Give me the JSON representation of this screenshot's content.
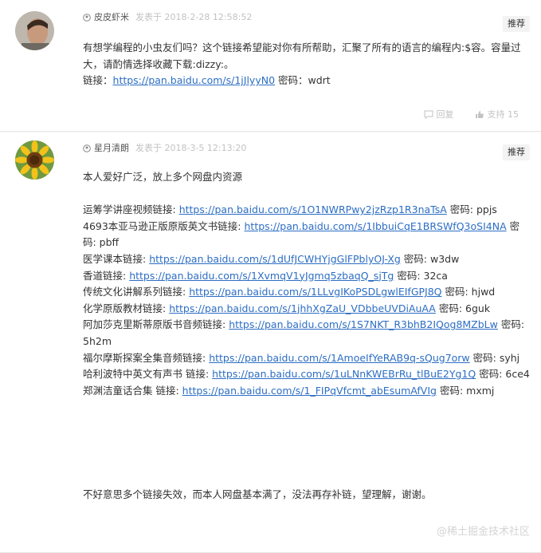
{
  "post1": {
    "username": "皮皮虾米",
    "time": "发表于 2018-2-28 12:58:52",
    "recommend": "推荐",
    "text1": "有想学编程的小虫友们吗？这个链接希望能对你有所帮助，汇聚了所有的语言的编程内:$容。容量过大，请酌情选择收藏下载:dizzy:。",
    "link_label": "链接：",
    "link": "https://pan.baidu.com/s/1jJlyyN0",
    "pwd": " 密码：wdrt",
    "reply": "回复",
    "support": "支持 15"
  },
  "post2": {
    "username": "星月清朗",
    "time": "发表于 2018-3-5 12:13:20",
    "recommend": "推荐",
    "intro": "本人爱好广泛，放上多个网盘内资源",
    "items": [
      {
        "label": "运筹学讲座视频链接: ",
        "link": "https://pan.baidu.com/s/1O1NWRPwy2jzRzp1R3naTsA",
        "pwd": " 密码: ppjs"
      },
      {
        "label": "4693本亚马逊正版原版英文书链接: ",
        "link": "https://pan.baidu.com/s/1IbbuiCqE1BRSWfQ3oSI4NA",
        "pwd": " 密码: pbff"
      },
      {
        "label": "医学课本链接: ",
        "link": "https://pan.baidu.com/s/1dUfJCWHYjgGlFPblyOJ-Xg",
        "pwd": " 密码: w3dw"
      },
      {
        "label": "香道链接: ",
        "link": "https://pan.baidu.com/s/1XvmqV1yJgmq5zbaqQ_sjTg",
        "pwd": " 密码: 32ca"
      },
      {
        "label": "传统文化讲解系列链接: ",
        "link": "https://pan.baidu.com/s/1LLvgIKoPSDLgwlEIfGPJ8Q",
        "pwd": " 密码: hjwd"
      },
      {
        "label": "化学原版教材链接: ",
        "link": "https://pan.baidu.com/s/1jhhXgZaU_VDbbeUVDiAuAA",
        "pwd": " 密码: 6guk"
      },
      {
        "label": "阿加莎克里斯蒂原版书音频链接: ",
        "link": "https://pan.baidu.com/s/1S7NKT_R3bhB2IQog8MZbLw",
        "pwd": " 密码: 5h2m"
      },
      {
        "label": "福尔摩斯探案全集音频链接: ",
        "link": "https://pan.baidu.com/s/1AmoeIfYeRAB9q-sQug7orw",
        "pwd": " 密码: syhj"
      },
      {
        "label": "哈利波特中英文有声书 链接: ",
        "link": "https://pan.baidu.com/s/1uLNnKWEBrRu_tlBuE2Yg1Q",
        "pwd": " 密码: 6ce4"
      },
      {
        "label": "郑渊洁童话合集 链接: ",
        "link": "https://pan.baidu.com/s/1_FIPqVfcmt_abEsumAfVIg",
        "pwd": " 密码: mxmj"
      }
    ],
    "outro": "不好意思多个链接失效，而本人网盘基本满了，没法再存补链，望理解，谢谢。"
  },
  "watermark": "@稀土掘金技术社区",
  "colors": {
    "link": "#2d6ec4",
    "muted": "#c2c2c2",
    "background": "#f4f5f5"
  },
  "icons": [
    "user-icon",
    "reply-icon",
    "thumbs-up-icon",
    "avatar"
  ]
}
